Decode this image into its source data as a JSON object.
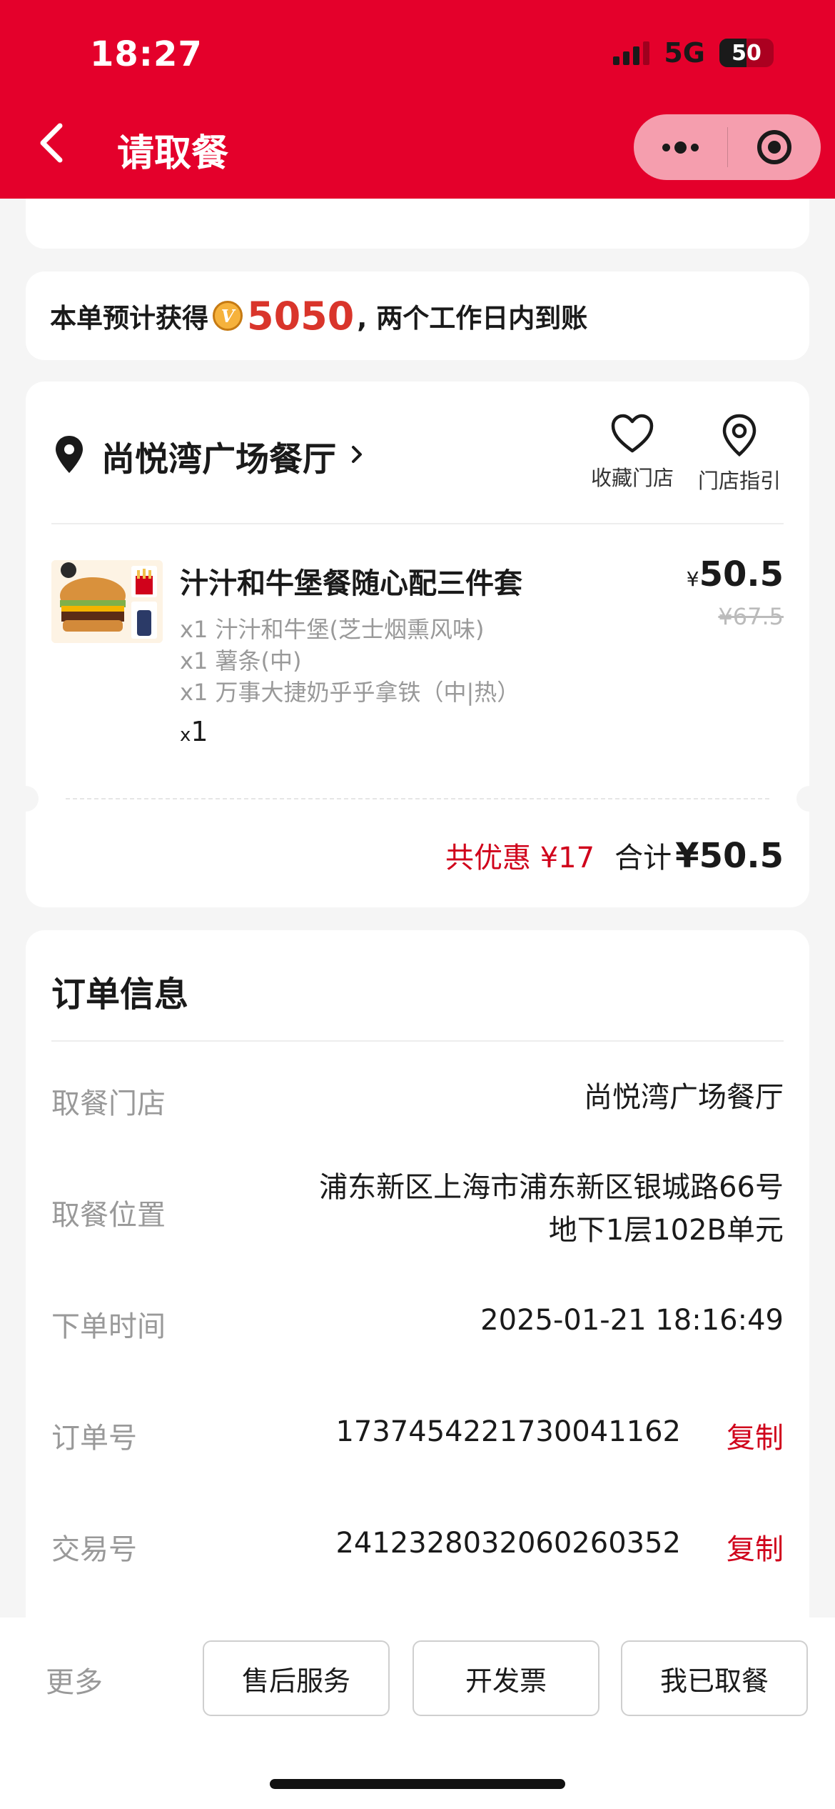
{
  "status_bar": {
    "time": "18:27",
    "network": "5G",
    "battery": "50"
  },
  "nav": {
    "title": "请取餐"
  },
  "points": {
    "prefix": "本单预计获得",
    "coin_letter": "V",
    "amount": "5050",
    "suffix": ", 两个工作日内到账"
  },
  "store": {
    "name": "尚悦湾广场餐厅",
    "favorite_label": "收藏门店",
    "guide_label": "门店指引"
  },
  "product": {
    "name": "汁汁和牛堡餐随心配三件套",
    "items": [
      "x1 汁汁和牛堡(芝士烟熏风味)",
      "x1 薯条(中)",
      "x1 万事大捷奶乎乎拿铁（中|热）"
    ],
    "qty_prefix": "x",
    "qty": "1",
    "currency": "¥",
    "price": "50.5",
    "original_price": "¥67.5"
  },
  "totals": {
    "discount": "共优惠 ¥17",
    "total_label": "合计",
    "total_value": "¥50.5"
  },
  "order_info": {
    "title": "订单信息",
    "rows": [
      {
        "label": "取餐门店",
        "value": "尚悦湾广场餐厅"
      },
      {
        "label": "取餐位置",
        "value_line1": "浦东新区上海市浦东新区银城路66号",
        "value_line2": "地下1层102B单元"
      },
      {
        "label": "下单时间",
        "value": "2025-01-21 18:16:49"
      },
      {
        "label": "订单号",
        "value": "1737454221730041162",
        "action": "复制"
      },
      {
        "label": "交易号",
        "value": "2412328032060260352",
        "action": "复制"
      }
    ]
  },
  "bottom": {
    "more": "更多",
    "buttons": [
      "售后服务",
      "开发票",
      "我已取餐"
    ]
  },
  "colors": {
    "brand_red": "#e4002b",
    "accent_red": "#d0021b",
    "points_red": "#d9352b",
    "background": "#f5f5f5"
  }
}
